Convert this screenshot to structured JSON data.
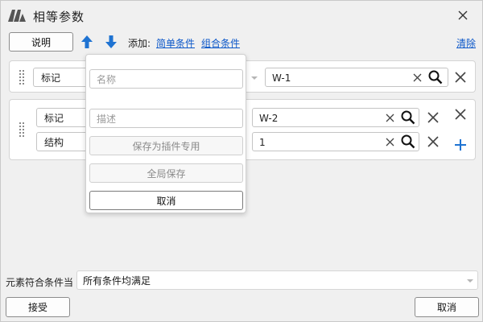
{
  "window": {
    "title": "相等参数"
  },
  "toolbar": {
    "help_label": "说明",
    "add_label": "添加:",
    "simple_condition_link": "简单条件",
    "compound_condition_link": "组合条件",
    "clear_link": "清除"
  },
  "conditions": {
    "group1": {
      "field": "标记",
      "value": "W-1"
    },
    "group2": {
      "rows": [
        {
          "field": "标记",
          "value": "W-2"
        },
        {
          "field": "结构",
          "value": "1"
        }
      ]
    }
  },
  "popup": {
    "name_placeholder": "名称",
    "description_placeholder": "描述",
    "save_as_plugin_label": "保存为插件专用",
    "global_save_label": "全局保存",
    "cancel_label": "取消"
  },
  "footer": {
    "match_label": "元素符合条件当",
    "match_value": "所有条件均满足",
    "accept_label": "接受",
    "cancel_label": "取消"
  },
  "colors": {
    "accent": "#1f73d2",
    "link": "#0b57c9"
  },
  "icons": [
    "app-logo",
    "close-icon",
    "arrow-up-icon",
    "arrow-down-icon",
    "grip-icon",
    "clear-icon",
    "search-icon",
    "remove-icon",
    "add-icon",
    "chevron-down-icon"
  ]
}
